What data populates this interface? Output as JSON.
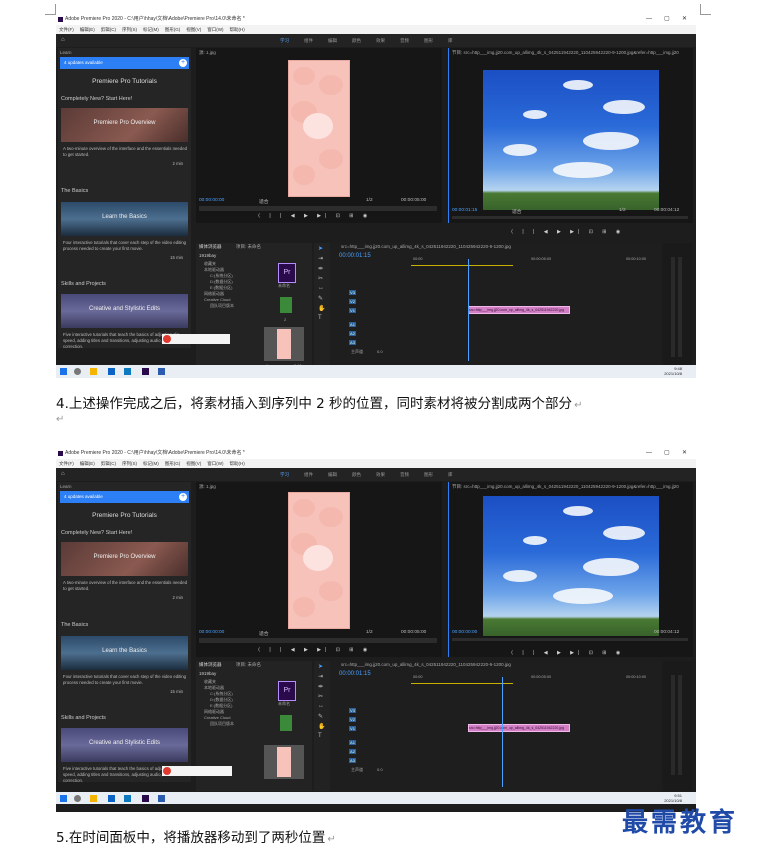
{
  "window": {
    "title": "Adobe Premiere Pro 2020 - C:\\用户\\hhay\\文档\\Adobe\\Premiere Pro\\14.0\\未命名 *",
    "minimize": "—",
    "maximize": "▢",
    "close": "✕"
  },
  "menu": [
    "文件(F)",
    "编辑(E)",
    "剪辑(C)",
    "序列(S)",
    "标记(M)",
    "图形(G)",
    "视图(V)",
    "窗口(W)",
    "帮助(H)"
  ],
  "workspaces": [
    "学习",
    "组件",
    "编辑",
    "颜色",
    "效果",
    "音频",
    "图形",
    "库"
  ],
  "learn": {
    "header": "Learn",
    "updates": "4 updates available",
    "plus": "+",
    "title": "Premiere Pro Tutorials",
    "section1": "Completely New? Start Here!",
    "card1": "Premiere Pro Overview",
    "desc1": "A two-minute overview of the interface and the essentials needed to get started.",
    "dur1": "2 min",
    "section2": "The Basics",
    "card2": "Learn the Basics",
    "desc2": "Four interactive tutorials that cover each step of the video editing process needed to create your first movie.",
    "dur2": "15 min",
    "section3": "Skills and Projects",
    "card3": "Creative and Stylistic Edits",
    "desc3": "Five interactive tutorials that teach the basics of adjusting clip speed, adding titles and transitions, adjusting audio, and color correction."
  },
  "source": {
    "header": "源: 1.jpg",
    "tc_left": "00:00:00:00",
    "fit": "适合",
    "ratio": "1/2",
    "tc_right": "00:00:05:00"
  },
  "program": {
    "header": "节目: src=http___img.jj20.com_up_allimg_4k_s_042511942220_110425942220-9-1200.jpg&refer=http___img.jj20",
    "tc_left_1": "00:00:01:15",
    "tc_left_2": "00:00:00:00",
    "fit": "适合",
    "ratio": "1/2",
    "tc_right": "00:00:04:12"
  },
  "controls": "⟨ | | ◀ ▶ ▶| ⊡ ⊞ ◉",
  "project": {
    "tabs": [
      "媒体浏览器",
      "项目: 未命名"
    ],
    "path": "1919bay",
    "tree": [
      "收藏夹",
      "本地驱动器",
      "C:(系统分区)",
      "D:(数据分区)",
      "E:(数据分区)",
      "网络驱动器",
      "Creative Cloud",
      "团队项目版本"
    ],
    "file_label": "未命名",
    "count": "2",
    "item": "1",
    "clip_dur": "5:00"
  },
  "timeline": {
    "tab": "src=http___img.jj20.com_up_allimg_4k_s_042511942220_110425942220-9-1200.jpg",
    "tc": "00:00:01:15",
    "ruler": [
      "00:00",
      "00:00:05:00",
      "00:00:10:00"
    ],
    "tracks": [
      "V3",
      "V2",
      "V1",
      "A1",
      "A2",
      "A3"
    ],
    "master": "主声道",
    "master_val": "0.0",
    "clip": "src=http___img.jj20.com_up_allimg_4k_s_042511942220.jpg"
  },
  "taskbar": {
    "time_1": "9:48",
    "date_1": "2021/10/8",
    "time_2": "9:51",
    "date_2": "2021/10/8"
  },
  "captions": {
    "step4": "4.上述操作完成之后，将素材插入到序列中 2 秒的位置，同时素材将被分割成两个部分",
    "step5": "5.在时间面板中，将播放器移动到了两秒位置"
  },
  "logo": "最需教育",
  "colors": {
    "accent": "#2d7ff5",
    "clip": "#d27fc5",
    "timecode": "#4aa0ff"
  }
}
